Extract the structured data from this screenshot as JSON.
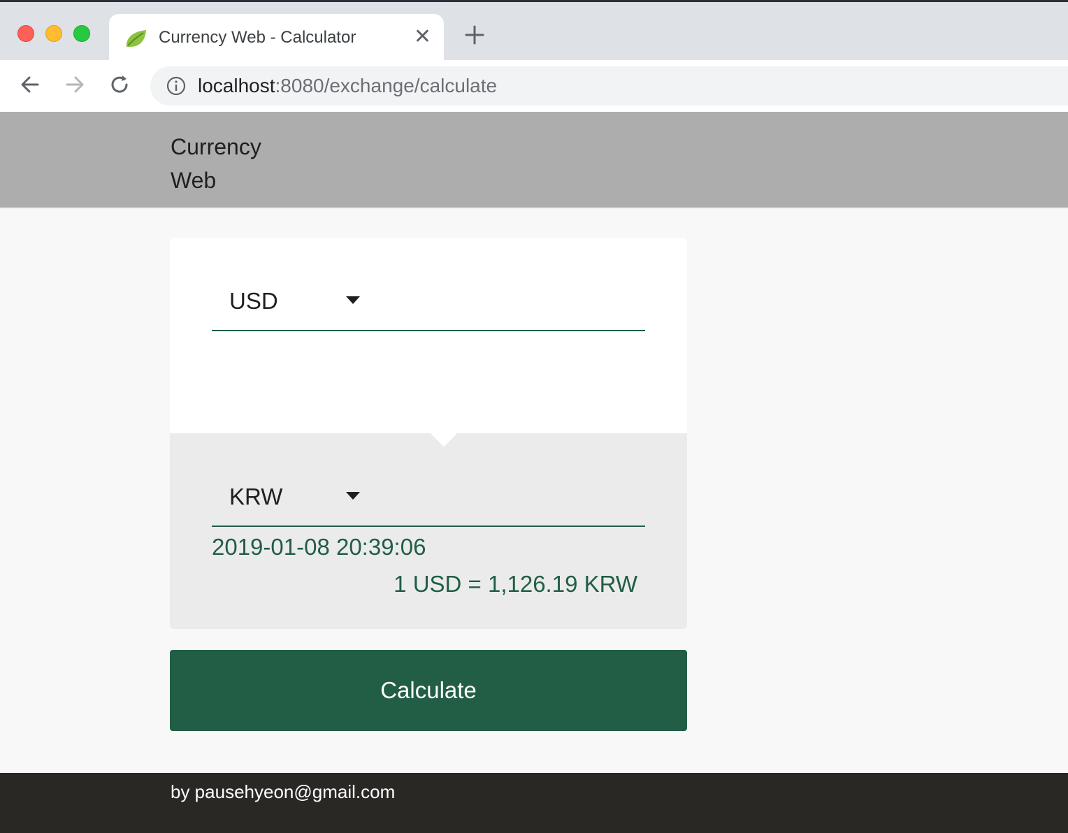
{
  "browser": {
    "tab": {
      "title": "Currency Web - Calculator",
      "favicon": "spring-leaf-icon",
      "close_label": "✕"
    },
    "new_tab_icon": "plus-icon",
    "nav": {
      "back_icon": "arrow-left-icon",
      "forward_icon": "arrow-right-icon",
      "reload_icon": "reload-icon"
    },
    "address": {
      "info_icon": "info-icon",
      "host": "localhost",
      "path": ":8080/exchange/calculate"
    }
  },
  "header": {
    "brand_line1": "Currency",
    "brand_line2": "Web"
  },
  "calculator": {
    "from_currency": "USD",
    "to_currency": "KRW",
    "timestamp": "2019-01-08 20:39:06",
    "rate_text": "1 USD = 1,126.19 KRW",
    "button_label": "Calculate"
  },
  "footer": {
    "text": "by pausehyeon@gmail.com"
  },
  "colors": {
    "accent": "#215e45",
    "header_bg": "#adadad",
    "footer_bg": "#2a2825",
    "page_bg": "#f8f8f8"
  }
}
